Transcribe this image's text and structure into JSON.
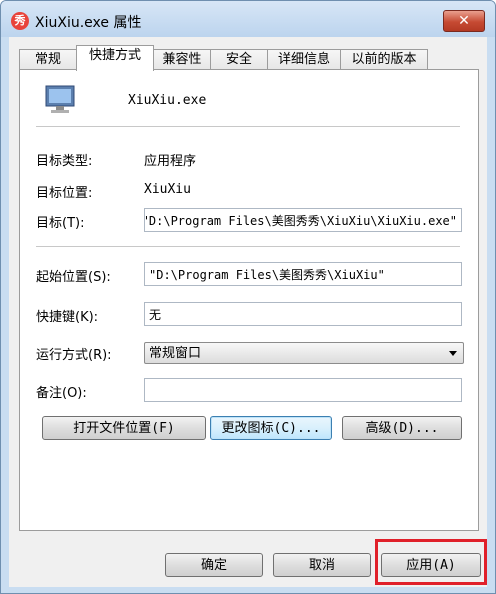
{
  "window": {
    "app_icon_letter": "秀",
    "title": "XiuXiu.exe 属性",
    "close_glyph": "✕"
  },
  "tabs": [
    "常规",
    "快捷方式",
    "兼容性",
    "安全",
    "详细信息",
    "以前的版本"
  ],
  "active_tab": "快捷方式",
  "shortcut": {
    "name": "XiuXiu.exe",
    "target_type_label": "目标类型:",
    "target_type_value": "应用程序",
    "target_location_label": "目标位置:",
    "target_location_value": "XiuXiu",
    "target_label": "目标(T):",
    "target_value": "\"D:\\Program Files\\美图秀秀\\XiuXiu\\XiuXiu.exe\"",
    "start_in_label": "起始位置(S):",
    "start_in_value": "\"D:\\Program Files\\美图秀秀\\XiuXiu\"",
    "shortcut_key_label": "快捷键(K):",
    "shortcut_key_value": "无",
    "run_label": "运行方式(R):",
    "run_value": "常规窗口",
    "comment_label": "备注(O):",
    "comment_value": ""
  },
  "panel_buttons": {
    "open_location": "打开文件位置(F)",
    "change_icon": "更改图标(C)...",
    "advanced": "高级(D)..."
  },
  "dialog_buttons": {
    "ok": "确定",
    "cancel": "取消",
    "apply": "应用(A)"
  },
  "colors": {
    "highlight_box": "#e0202a",
    "title_gradient_top": "#d7e6f6",
    "close_button": "#c64a33"
  }
}
